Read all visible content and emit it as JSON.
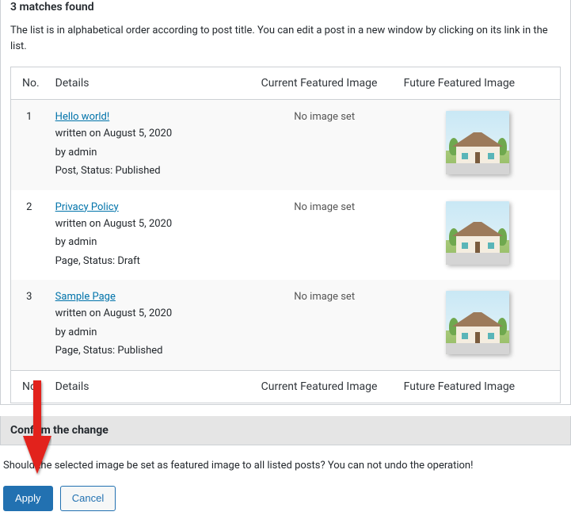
{
  "header": {
    "matches_heading": "3 matches found",
    "intro": "The list is in alphabetical order according to post title. You can edit a post in a new window by clicking on its link in the list."
  },
  "columns": {
    "no": "No.",
    "details": "Details",
    "current": "Current Featured Image",
    "future": "Future Featured Image"
  },
  "rows": [
    {
      "no": "1",
      "title": "Hello world!",
      "written": "written on August 5, 2020",
      "by": "by admin",
      "meta": "Post, Status: Published",
      "current": "No image set"
    },
    {
      "no": "2",
      "title": "Privacy Policy",
      "written": "written on August 5, 2020",
      "by": "by admin",
      "meta": "Page, Status: Draft",
      "current": "No image set"
    },
    {
      "no": "3",
      "title": "Sample Page",
      "written": "written on August 5, 2020",
      "by": "by admin",
      "meta": "Page, Status: Published",
      "current": "No image set"
    }
  ],
  "confirm": {
    "heading": "Confirm the change",
    "text": "Should the selected image be set as featured image to all listed posts? You can not undo the operation!",
    "apply": "Apply",
    "cancel": "Cancel"
  }
}
